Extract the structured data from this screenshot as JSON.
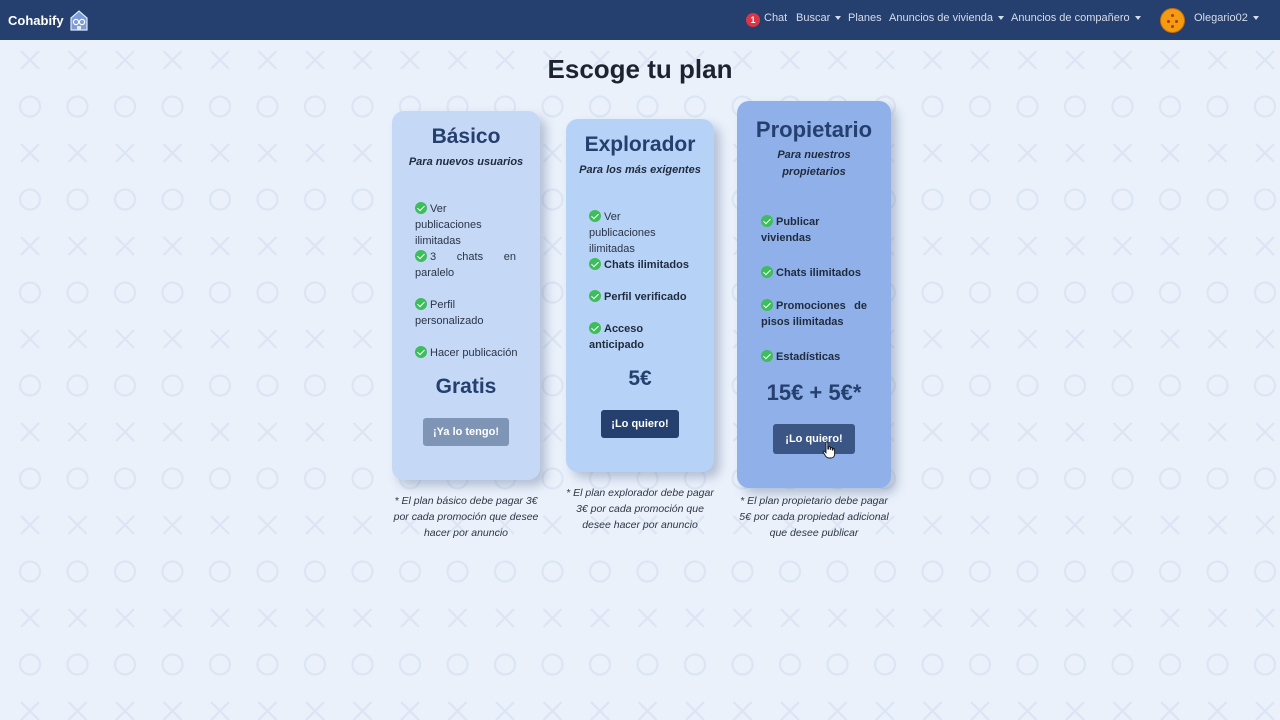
{
  "navbar": {
    "brand": "Cohabify",
    "chat_badge": "1",
    "chat_label": "Chat",
    "buscar_label": "Buscar",
    "planes_label": "Planes",
    "anuncios_vivienda_label": "Anuncios de vivienda",
    "anuncios_companero_label": "Anuncios de compañero",
    "username": "Olegario02"
  },
  "page_title": "Escoge tu plan",
  "plans": [
    {
      "name": "Básico",
      "subtitle": "Para nuevos usuarios",
      "features": [
        "Ver publicaciones ilimitadas",
        "3 chats en paralelo",
        "Perfil personalizado",
        "Hacer publicación"
      ],
      "price": "Gratis",
      "button": "¡Ya lo tengo!",
      "note": "* El plan básico debe pagar 3€ por cada promoción que desee hacer por anuncio"
    },
    {
      "name": "Explorador",
      "subtitle": "Para los más exigentes",
      "features": [
        "Ver publicaciones ilimitadas",
        "Chats ilimitados",
        "Perfil verificado",
        "Acceso anticipado"
      ],
      "price": "5€",
      "button": "¡Lo quiero!",
      "note": "* El plan explorador debe pagar 3€ por cada promoción que desee hacer por anuncio"
    },
    {
      "name": "Propietario",
      "subtitle": "Para nuestros propietarios",
      "features": [
        "Publicar viviendas",
        "Chats ilimitados",
        "Promociones de pisos ilimitadas",
        "Estadísticas"
      ],
      "price": "15€ + 5€*",
      "button": "¡Lo quiero!",
      "note": "* El plan propietario debe pagar 5€ por cada propiedad adicional que desee publicar"
    }
  ],
  "colors": {
    "navbar": "#253f6e",
    "background": "#eaf1fb",
    "card_basic": "#c5d9f7",
    "card_explorer": "#b7d2f7",
    "card_owner": "#8fb0e9",
    "accent": "#253f6e",
    "check": "#3dbd5c",
    "badge": "#dc3545",
    "button_disabled": "#7f95b5"
  },
  "icons": {
    "logo": "house-logo-icon",
    "check": "check-circle-icon",
    "caret": "caret-down-icon",
    "avatar": "dragon-ball-avatar-icon",
    "cursor": "hand-pointer-icon"
  }
}
